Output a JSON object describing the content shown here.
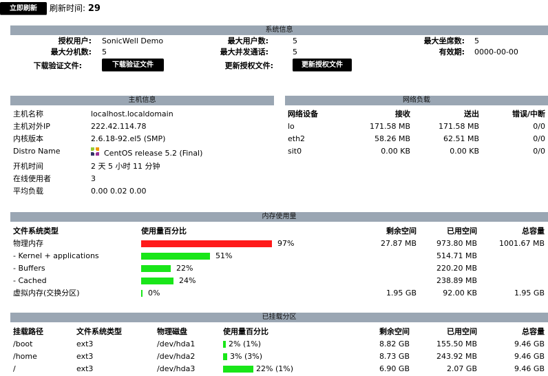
{
  "toolbar": {
    "refresh_button": "立即刷新",
    "refresh_label": "刷新时间:",
    "refresh_seconds": "29"
  },
  "system_info": {
    "title": "系统信息",
    "licensed_user_label": "授权用户:",
    "licensed_user": "SonicWell Demo",
    "max_users_label": "最大用户数:",
    "max_users": "5",
    "max_seats_label": "最大坐席数:",
    "max_seats": "5",
    "max_ext_label": "最大分机数:",
    "max_ext": "5",
    "max_calls_label": "最大并发通话:",
    "max_calls": "5",
    "expiry_label": "有效期:",
    "expiry": "0000-00-00",
    "download_label": "下载验证文件:",
    "download_button": "下载验证文件",
    "update_label": "更新授权文件:",
    "update_button": "更新授权文件"
  },
  "host_info": {
    "title": "主机信息",
    "rows": [
      {
        "label": "主机名称",
        "value": "localhost.localdomain"
      },
      {
        "label": "主机对外IP",
        "value": "222.42.114.78"
      },
      {
        "label": "内核版本",
        "value": "2.6.18-92.el5 (SMP)"
      },
      {
        "label": "Distro Name",
        "value": "CentOS release 5.2 (Final)"
      },
      {
        "label": "开机时间",
        "value": "2 天 5 小时 11 分钟"
      },
      {
        "label": "在线使用者",
        "value": "3"
      },
      {
        "label": "平均负载",
        "value": "0.00 0.02 0.00"
      }
    ]
  },
  "network": {
    "title": "网络负载",
    "headers": [
      "网络设备",
      "接收",
      "送出",
      "错误/中断"
    ],
    "rows": [
      {
        "dev": "lo",
        "rx": "171.58 MB",
        "tx": "171.58 MB",
        "err": "0/0"
      },
      {
        "dev": "eth2",
        "rx": "58.26 MB",
        "tx": "62.51 MB",
        "err": "0/0"
      },
      {
        "dev": "sit0",
        "rx": "0.00 KB",
        "tx": "0.00 KB",
        "err": "0/0"
      }
    ]
  },
  "memory": {
    "title": "内存使用量",
    "headers": [
      "文件系统类型",
      "使用量百分比",
      "剩余空间",
      "已用空间",
      "总容量"
    ],
    "rows": [
      {
        "name": "物理内存",
        "pct": 97,
        "pct_text": "97%",
        "color": "#ff1a1a",
        "free": "27.87 MB",
        "used": "973.80 MB",
        "total": "1001.67 MB"
      },
      {
        "name": "- Kernel + applications",
        "pct": 51,
        "pct_text": "51%",
        "color": "#19e619",
        "free": "",
        "used": "514.71 MB",
        "total": ""
      },
      {
        "name": "- Buffers",
        "pct": 22,
        "pct_text": "22%",
        "color": "#19e619",
        "free": "",
        "used": "220.20 MB",
        "total": ""
      },
      {
        "name": "- Cached",
        "pct": 24,
        "pct_text": "24%",
        "color": "#19e619",
        "free": "",
        "used": "238.89 MB",
        "total": ""
      },
      {
        "name": "虚拟内存(交换分区)",
        "pct": 0,
        "pct_text": "0%",
        "color": "#19e619",
        "free": "1.95 GB",
        "used": "92.00 KB",
        "total": "1.95 GB"
      }
    ]
  },
  "mounts": {
    "title": "已挂载分区",
    "headers": [
      "挂载路径",
      "文件系统类型",
      "物理磁盘",
      "使用量百分比",
      "剩余空间",
      "已用空间",
      "总容量"
    ],
    "rows": [
      {
        "path": "/boot",
        "fs": "ext3",
        "disk": "/dev/hda1",
        "pct": 2,
        "pct_text": "2% (1%)",
        "free": "8.82 GB",
        "used": "155.50 MB",
        "total": "9.46 GB"
      },
      {
        "path": "/home",
        "fs": "ext3",
        "disk": "/dev/hda2",
        "pct": 3,
        "pct_text": "3% (3%)",
        "free": "8.73 GB",
        "used": "243.92 MB",
        "total": "9.46 GB"
      },
      {
        "path": "/",
        "fs": "ext3",
        "disk": "/dev/hda3",
        "pct": 22,
        "pct_text": "22% (1%)",
        "free": "6.90 GB",
        "used": "2.07 GB",
        "total": "9.46 GB"
      }
    ]
  }
}
